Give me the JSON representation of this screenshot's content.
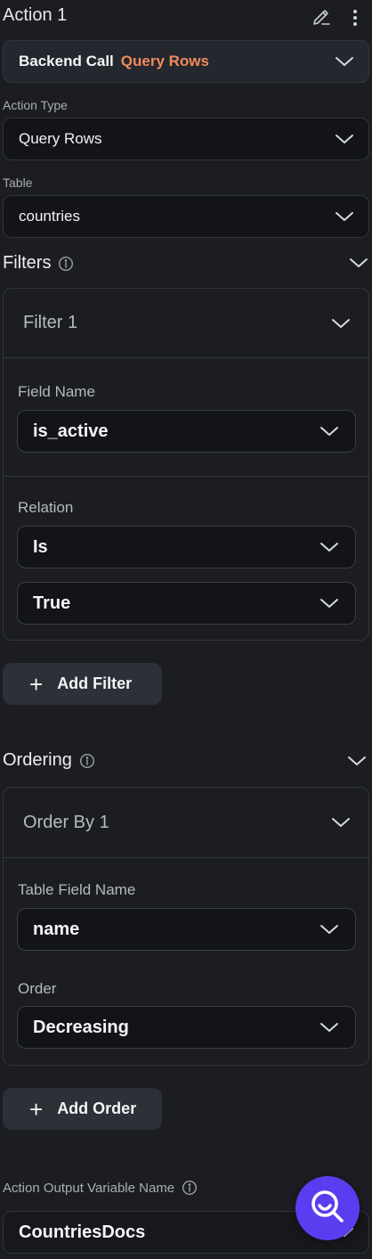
{
  "header": {
    "title": "Action 1"
  },
  "backend_call": {
    "label": "Backend Call",
    "type": "Query Rows",
    "type_color": "#f08a5d"
  },
  "action_type": {
    "label": "Action Type",
    "value": "Query Rows"
  },
  "table": {
    "label": "Table",
    "value": "countries"
  },
  "filters": {
    "title": "Filters",
    "card": {
      "title": "Filter 1",
      "field_name_label": "Field Name",
      "field_name_value": "is_active",
      "relation_label": "Relation",
      "relation_value": "Is",
      "value": "True"
    },
    "add_label": "Add Filter"
  },
  "ordering": {
    "title": "Ordering",
    "card": {
      "title": "Order By 1",
      "field_label": "Table Field Name",
      "field_value": "name",
      "order_label": "Order",
      "order_value": "Decreasing"
    },
    "add_label": "Add Order"
  },
  "output": {
    "label": "Action Output Variable Name",
    "value": "CountriesDocs"
  },
  "colors": {
    "background": "#1b1d22",
    "fab": "#5b3df0",
    "accent": "#f08a5d"
  }
}
